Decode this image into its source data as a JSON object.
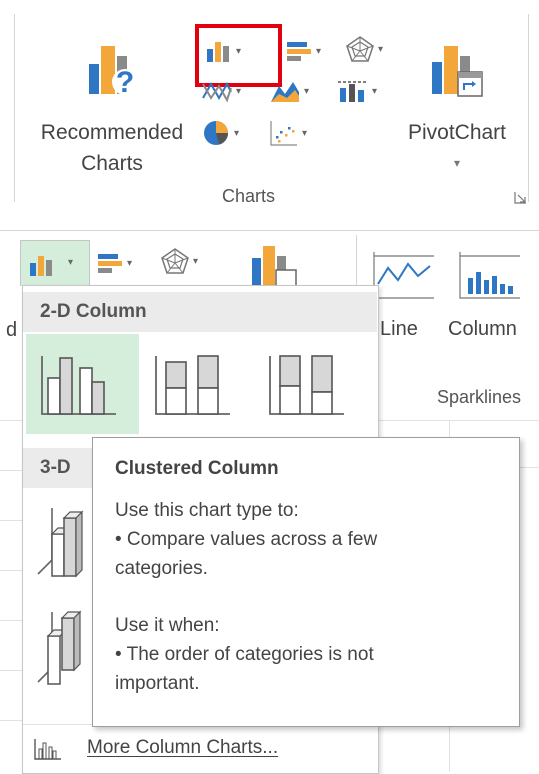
{
  "ribbon": {
    "recommended_line1": "Recommended",
    "recommended_line2": "Charts",
    "pivotchart_label": "PivotChart",
    "group_label": "Charts",
    "dropdown_arrow": "▾"
  },
  "lower_ribbon": {
    "sparkline_line": "Line",
    "sparkline_column": "Column",
    "sparklines_group": "Sparklines",
    "truncated_left": "d"
  },
  "dropdown": {
    "section_2d": "2-D Column",
    "section_3d": "3-D",
    "more_charts": "More Column Charts..."
  },
  "tooltip": {
    "title": "Clustered Column",
    "use_to": "Use this chart type to:",
    "bullet1_line1": "• Compare values across a few",
    "bullet1_line2": "categories.",
    "use_when": "Use it when:",
    "bullet2_line1": "• The order of categories is not",
    "bullet2_line2": "important."
  },
  "colors": {
    "highlight_border": "#e00010",
    "selected_tile": "#d4eedb",
    "excel_blue": "#2f77c4",
    "excel_orange": "#f3a73b",
    "excel_gray": "#8a8a8a"
  }
}
